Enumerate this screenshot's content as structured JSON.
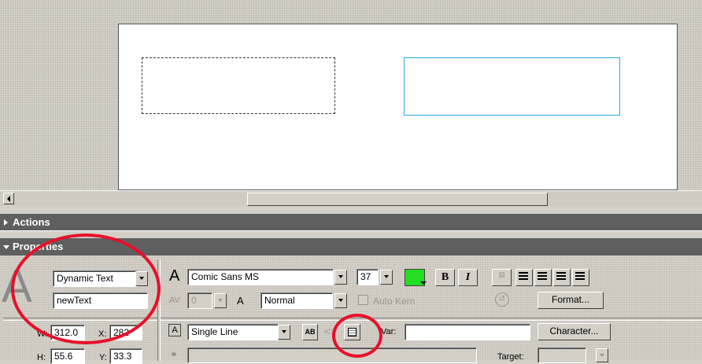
{
  "stage": {},
  "panels": {
    "actions_title": "Actions",
    "properties_title": "Properties"
  },
  "properties": {
    "text_type": "Dynamic Text",
    "instance_name": "newText",
    "font": "Comic Sans MS",
    "font_size": "37",
    "text_color": "#22dd22",
    "bold_label": "B",
    "italic_label": "I",
    "kerning_value": "0",
    "char_position": "Normal",
    "auto_kern_label": "Auto Kern",
    "format_button": "Format...",
    "character_button": "Character...",
    "line_type": "Single Line",
    "var_label": "Var:",
    "var_value": "",
    "target_label": "Target:",
    "w_label": "W:",
    "w_value": "312.0",
    "x_label": "X:",
    "x_value": "282",
    "h_label": "H:",
    "h_value": "55.6",
    "y_label": "Y:",
    "y_value": "33.3",
    "big_icon_letter": "A",
    "font_icon_letter": "A",
    "kern_icon_letter": "AV",
    "pos_icon_letter": "A",
    "render_icon_label": "AB"
  },
  "annotations": {
    "circle_color": "#e8102a"
  }
}
